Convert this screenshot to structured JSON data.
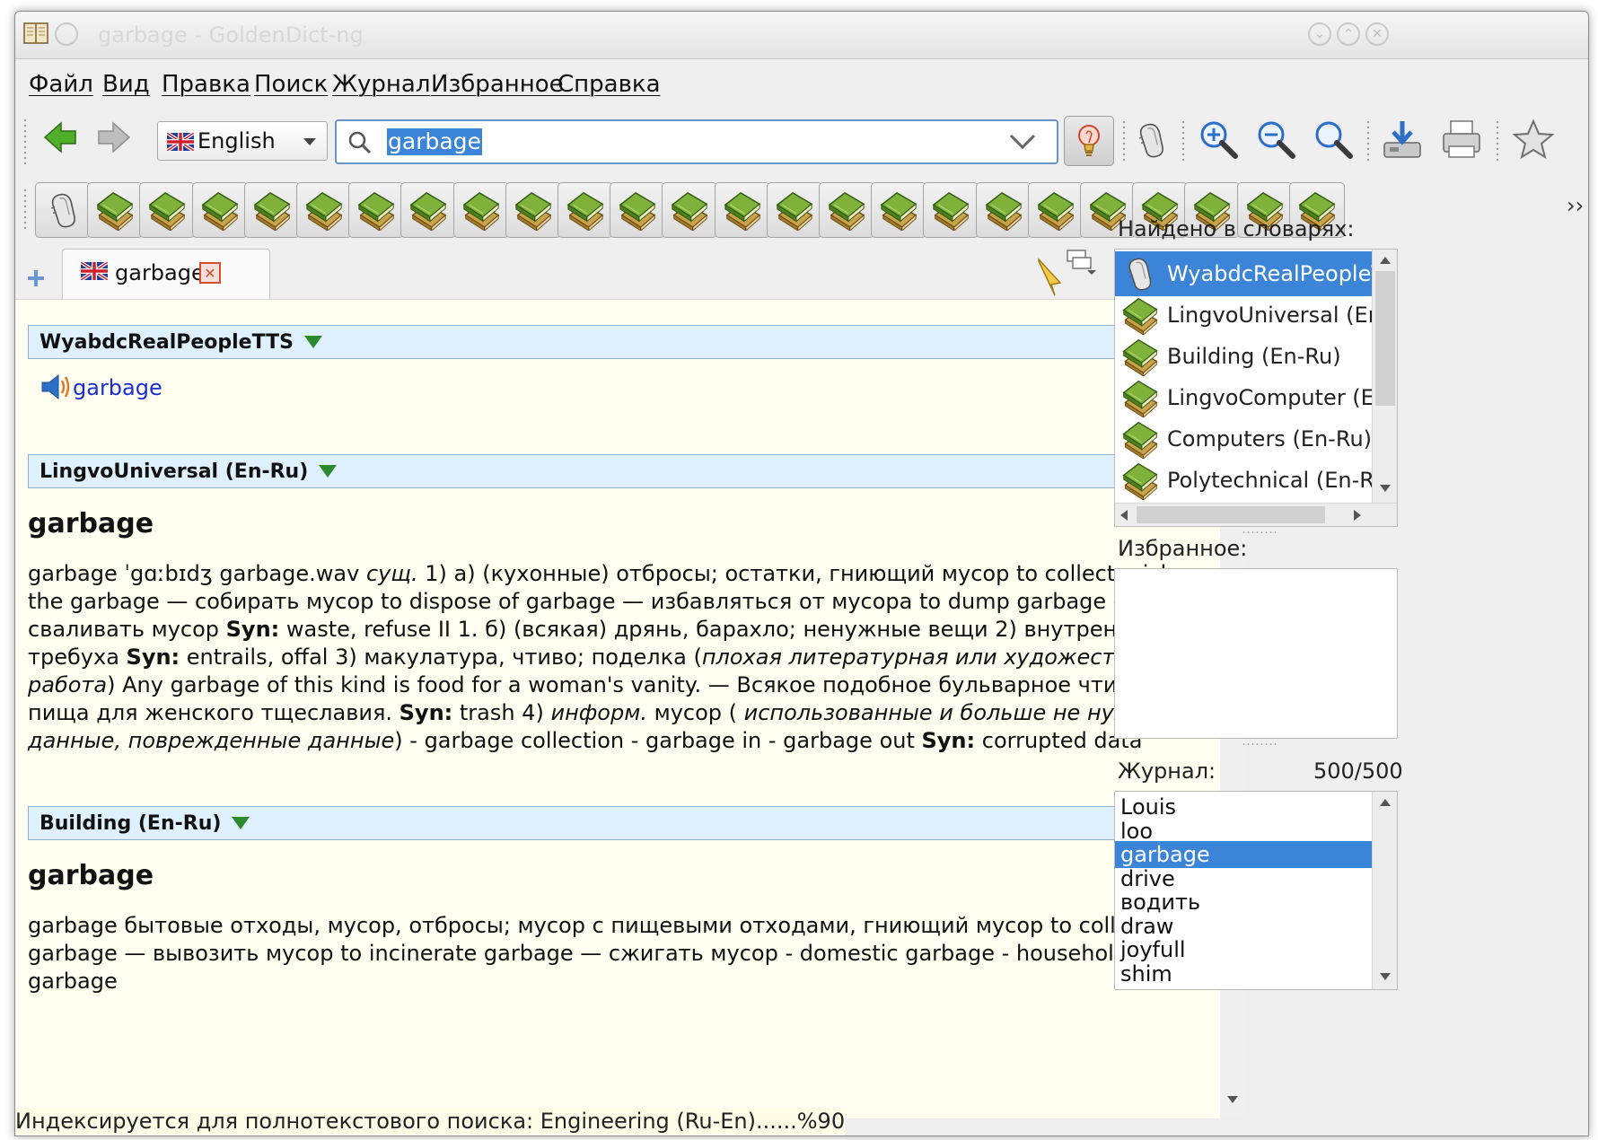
{
  "window": {
    "title": "garbage - GoldenDict-ng"
  },
  "menu": [
    "Файл",
    "Вид",
    "Правка",
    "Поиск",
    "Журнал",
    "Избранное",
    "Справка"
  ],
  "toolbar": {
    "language": "English",
    "search_value": "garbage",
    "icons": [
      "back-arrow-icon",
      "forward-arrow-icon",
      "lightbulb-icon",
      "pronounce-icon",
      "zoom-in-icon",
      "zoom-out-icon",
      "zoom-reset-icon",
      "save-icon",
      "print-icon",
      "favorite-star-icon"
    ]
  },
  "dictbar": {
    "count": 25,
    "overflow_label": "››"
  },
  "tabs": [
    {
      "label": "garbage"
    }
  ],
  "article": {
    "sections": [
      {
        "dict": "WyabdcRealPeopleTTS",
        "audio_word": "garbage"
      },
      {
        "dict": "LingvoUniversal (En-Ru)",
        "headword": "garbage",
        "body_html": "garbage ˈgɑːbɪdʒ garbage.wav <i>сущ.</i> 1) а) (кухонные) отбросы; остатки, гниющий мусор to collect, pick up the garbage — собирать мусор to dispose of garbage — избавляться от мусора to dump garbage — сваливать мусор <b>Syn:</b> waste, refuse II 1. б) (всякая) дрянь, барахло; ненужные вещи 2) внутренности, требуха <b>Syn:</b> entrails, offal 3) макулатура, чтиво; поделка (<i>плохая литературная или художественная работа</i>) Any garbage of this kind is food for a woman's vanity. — Всякое подобное бульварное чтиво - пища для женского тщеславия. <b>Syn:</b> trash 4) <i>информ.</i> мусор ( <i>использованные и больше не нужные данные, поврежденные данные</i>) - garbage collection - garbage in - garbage out <b>Syn:</b> corrupted data"
      },
      {
        "dict": "Building (En-Ru)",
        "headword": "garbage",
        "body_html": "garbage бытовые отходы, мусор, отбросы; мусор с пищевыми отходами, гниющий мусор to collect garbage — вывозить мусор to incinerate garbage — сжигать мусор - domestic garbage - household garbage"
      }
    ]
  },
  "status": "Индексируется для полнотекстового поиска: Engineering (Ru-En)......%90",
  "sidebar": {
    "found_label": "Найдено в словарях:",
    "found": [
      {
        "name": "WyabdcRealPeopleTTS",
        "icon": "tts-icon",
        "selected": true
      },
      {
        "name": "LingvoUniversal (En-Ru)",
        "icon": "book-icon"
      },
      {
        "name": "Building (En-Ru)",
        "icon": "book-icon"
      },
      {
        "name": "LingvoComputer (En-Ru)",
        "icon": "book-icon"
      },
      {
        "name": "Computers (En-Ru)",
        "icon": "book-icon"
      },
      {
        "name": "Polytechnical (En-Ru)",
        "icon": "book-icon"
      }
    ],
    "favorites_label": "Избранное:",
    "history_label": "Журнал:",
    "history_count": "500/500",
    "history": [
      "Louis",
      "loo",
      "garbage",
      "drive",
      "водить",
      "draw",
      "joyfull",
      "shim"
    ],
    "history_selected": 2
  }
}
